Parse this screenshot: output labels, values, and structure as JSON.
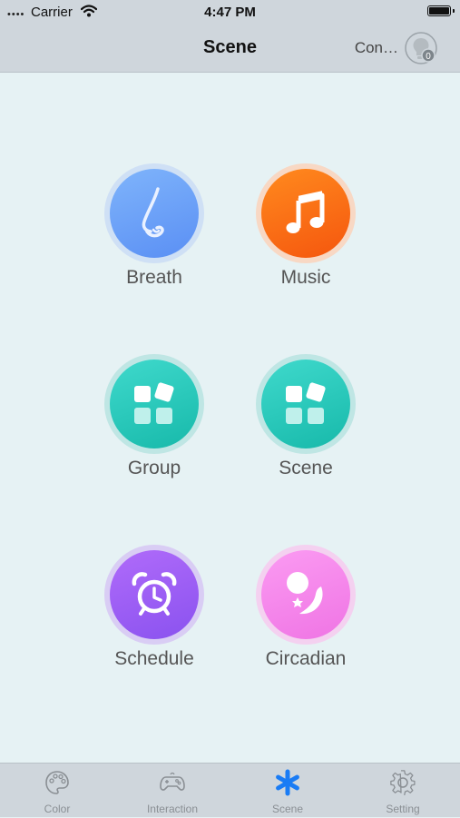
{
  "status_bar": {
    "signal": "••••",
    "carrier": "Carrier",
    "time": "4:47 PM"
  },
  "nav": {
    "title": "Scene",
    "connect_label": "Con…",
    "bulb_count": "0"
  },
  "tiles": [
    {
      "label": "Breath",
      "icon": "nose-icon"
    },
    {
      "label": "Music",
      "icon": "music-note-icon"
    },
    {
      "label": "Group",
      "icon": "grid-blocks-icon"
    },
    {
      "label": "Scene",
      "icon": "grid-blocks-icon"
    },
    {
      "label": "Schedule",
      "icon": "alarm-clock-icon"
    },
    {
      "label": "Circadian",
      "icon": "moon-star-icon"
    }
  ],
  "tabs": [
    {
      "label": "Color",
      "icon": "palette-icon"
    },
    {
      "label": "Interaction",
      "icon": "gamepad-icon"
    },
    {
      "label": "Scene",
      "icon": "asterisk-icon",
      "active": true
    },
    {
      "label": "Setting",
      "icon": "gear-icon"
    }
  ],
  "colors": {
    "accent": "#1a7cf5",
    "breath": "#6a9ff7",
    "music": "#f8661a",
    "group": "#22c4b6",
    "scene": "#22c4b6",
    "schedule": "#9a5cf4",
    "circadian": "#f485ea"
  }
}
